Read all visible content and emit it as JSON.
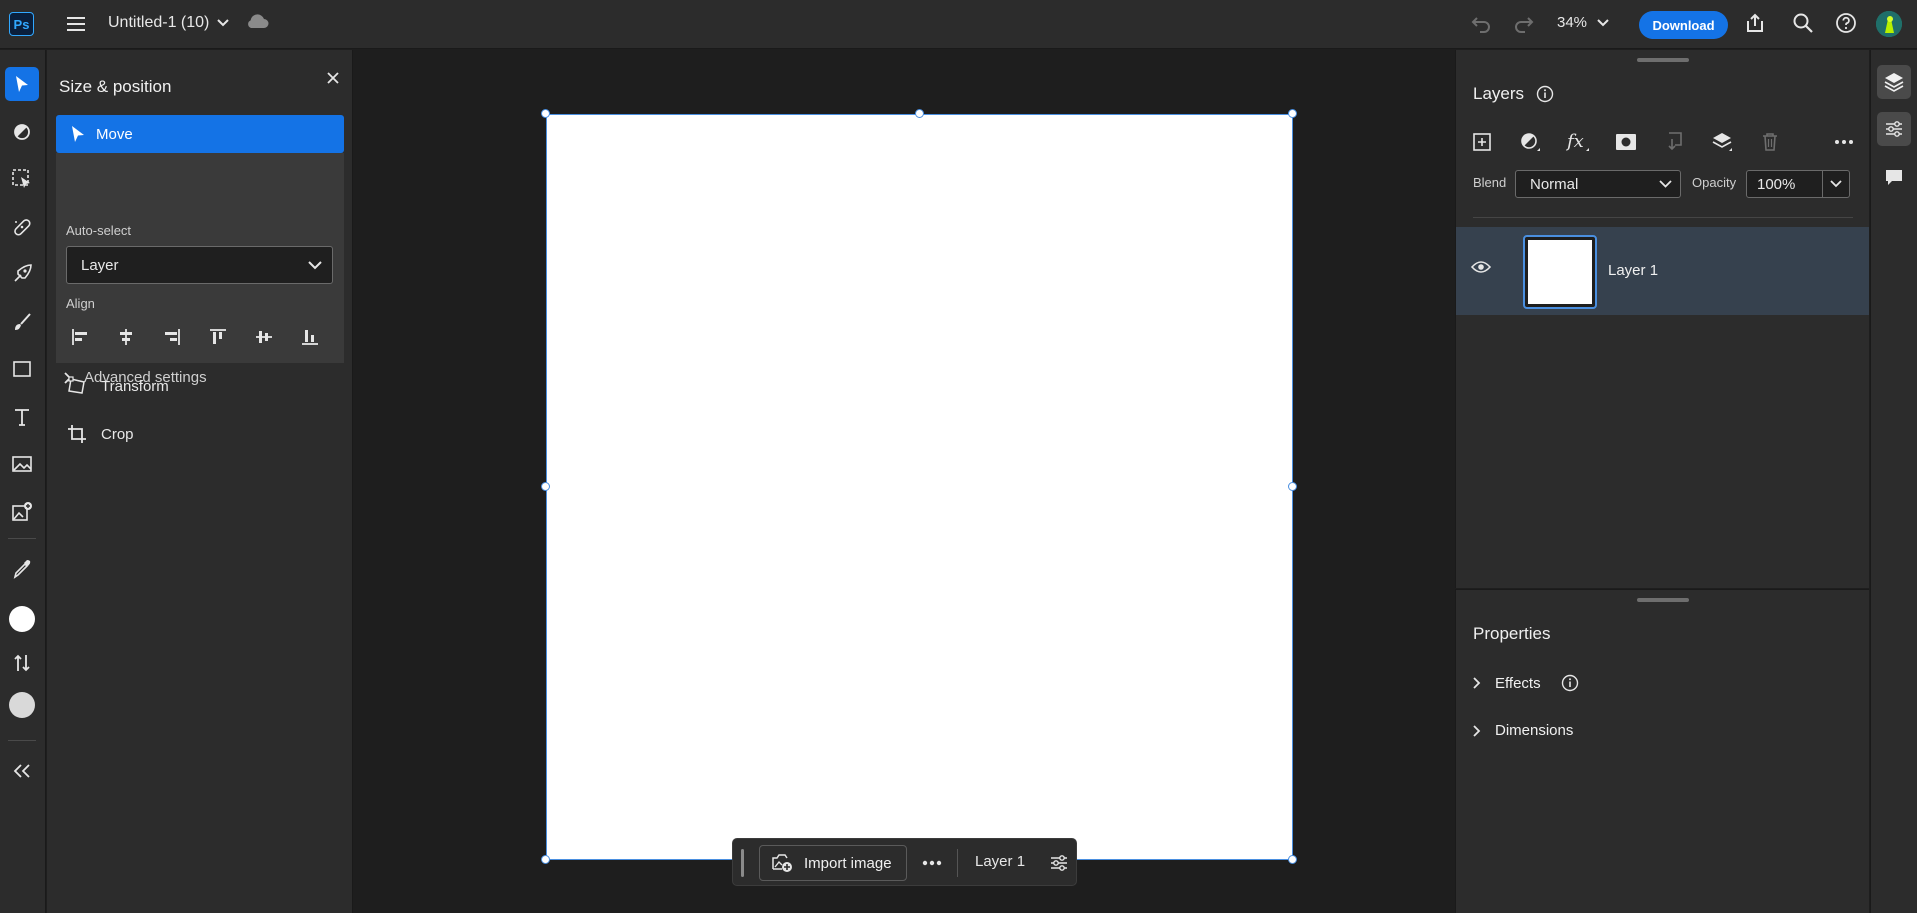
{
  "app": {
    "logo": "Ps",
    "doc_title": "Untitled-1 (10)",
    "zoom": "34%",
    "download_label": "Download"
  },
  "size_position": {
    "title": "Size & position",
    "move_label": "Move",
    "autoselect_label": "Auto-select",
    "autoselect_value": "Layer",
    "align_label": "Align",
    "advanced_label": "Advanced settings",
    "transform_label": "Transform",
    "crop_label": "Crop"
  },
  "context_bar": {
    "import_label": "Import image",
    "layer_label": "Layer 1"
  },
  "layers": {
    "title": "Layers",
    "blend_label": "Blend",
    "blend_value": "Normal",
    "opacity_label": "Opacity",
    "opacity_value": "100%",
    "items": [
      {
        "name": "Layer 1"
      }
    ]
  },
  "properties": {
    "title": "Properties",
    "sections": [
      {
        "label": "Effects"
      },
      {
        "label": "Dimensions"
      }
    ]
  },
  "colors": {
    "accent": "#1473e6",
    "panel_bg": "#2c2c2c",
    "canvas_bg": "#1e1e1e",
    "selected_layer": "#36414e",
    "selection_outline": "#4a8fe0"
  }
}
